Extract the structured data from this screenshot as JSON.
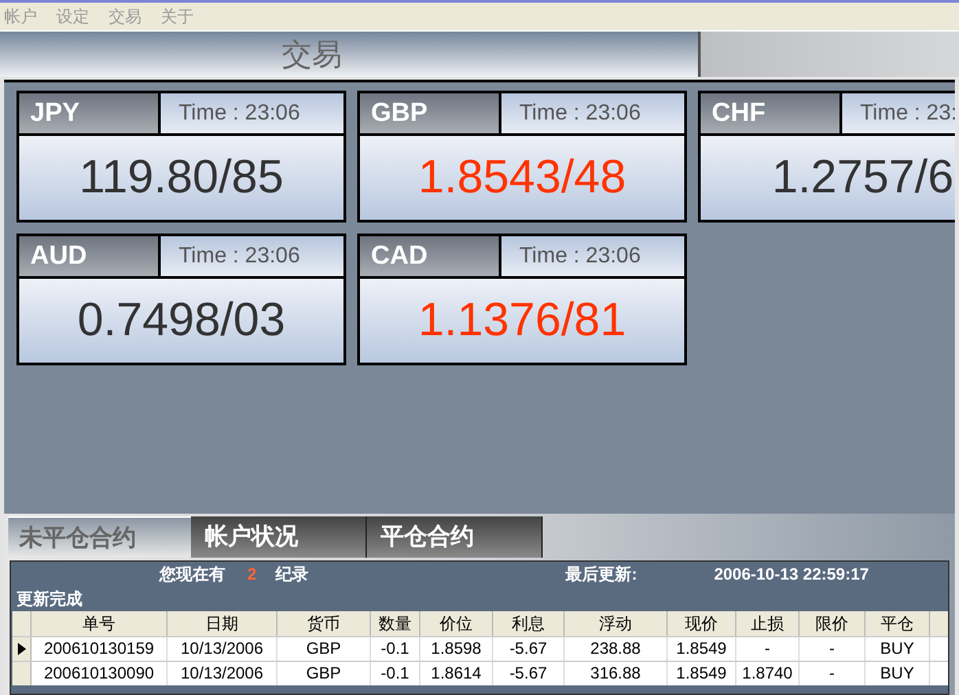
{
  "menu": [
    "帐户",
    "设定",
    "交易",
    "关于"
  ],
  "header": {
    "title": "交易"
  },
  "quotes": [
    {
      "currency": "JPY",
      "time": "Time : 23:06",
      "price": "119.80/85",
      "color": "#333333"
    },
    {
      "currency": "GBP",
      "time": "Time : 23:06",
      "price": "1.8543/48",
      "color": "#ff3300"
    },
    {
      "currency": "CHF",
      "time": "Time : 23:",
      "price": "1.2757/6",
      "color": "#333333"
    },
    {
      "currency": "AUD",
      "time": "Time : 23:06",
      "price": "0.7498/03",
      "color": "#333333"
    },
    {
      "currency": "CAD",
      "time": "Time : 23:06",
      "price": "1.1376/81",
      "color": "#ff3300"
    }
  ],
  "tabs": [
    {
      "label": "未平仓合约",
      "selected": true
    },
    {
      "label": "帐户状况",
      "selected": false
    },
    {
      "label": "平仓合约",
      "selected": false
    }
  ],
  "summary": {
    "prefix": "您现在有",
    "count": "2",
    "suffix": "纪录",
    "updated_label": "最后更新:",
    "updated_value": "2006-10-13 22:59:17",
    "status": "更新完成"
  },
  "table": {
    "columns": [
      "单号",
      "日期",
      "货币",
      "数量",
      "价位",
      "利息",
      "浮动",
      "现价",
      "止损",
      "限价",
      "平仓"
    ],
    "rows": [
      {
        "selected": true,
        "cells": [
          "200610130159",
          "10/13/2006",
          "GBP",
          "-0.1",
          "1.8598",
          "-5.67",
          "238.88",
          "1.8549",
          "-",
          "-",
          "BUY"
        ]
      },
      {
        "selected": false,
        "cells": [
          "200610130090",
          "10/13/2006",
          "GBP",
          "-0.1",
          "1.8614",
          "-5.67",
          "316.88",
          "1.8549",
          "1.8740",
          "-",
          "BUY"
        ]
      }
    ]
  }
}
